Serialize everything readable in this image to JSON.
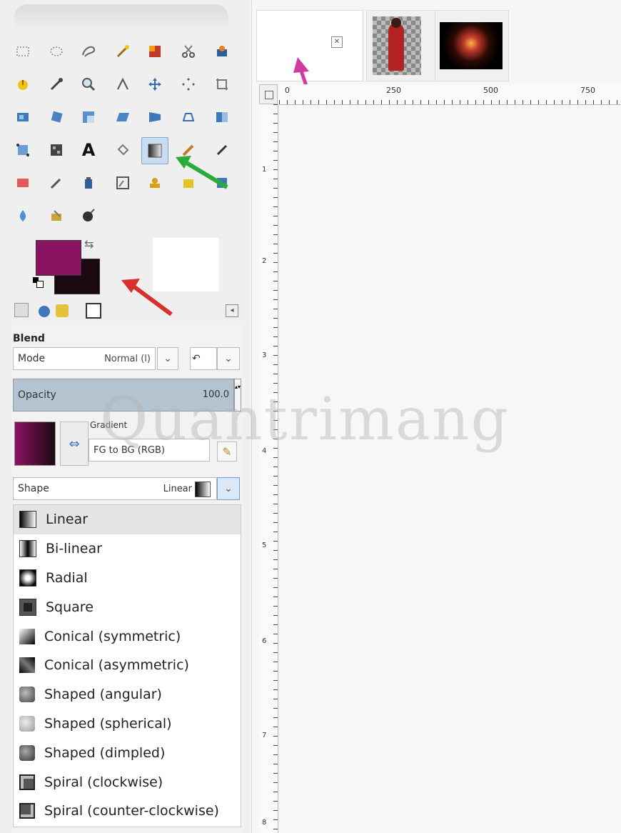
{
  "toolbox": {
    "blend_label": "Blend",
    "mode_label": "Mode",
    "mode_value": "Normal (l)",
    "opacity_label": "Opacity",
    "opacity_value": "100.0",
    "gradient_label": "Gradient",
    "gradient_value": "FG to BG (RGB)",
    "shape_label": "Shape",
    "shape_value": "Linear",
    "colors": {
      "foreground": "#8a1462",
      "background": "#1b0810"
    }
  },
  "shape_menu": {
    "items": [
      "Linear",
      "Bi-linear",
      "Radial",
      "Square",
      "Conical (symmetric)",
      "Conical (asymmetric)",
      "Shaped (angular)",
      "Shaped (spherical)",
      "Shaped (dimpled)",
      "Spiral (clockwise)",
      "Spiral (counter-clockwise)"
    ],
    "selected": "Linear"
  },
  "rulers": {
    "horizontal": [
      "0",
      "250",
      "500",
      "750"
    ],
    "vertical": [
      "1",
      "2",
      "3",
      "4",
      "5",
      "6",
      "7",
      "8"
    ]
  },
  "watermark": "Quantrimang",
  "annotation_arrow_colors": {
    "pink": "#d23a9b",
    "green": "#2bab3b",
    "red": "#d8302c",
    "blue": "#3aa6dd"
  }
}
